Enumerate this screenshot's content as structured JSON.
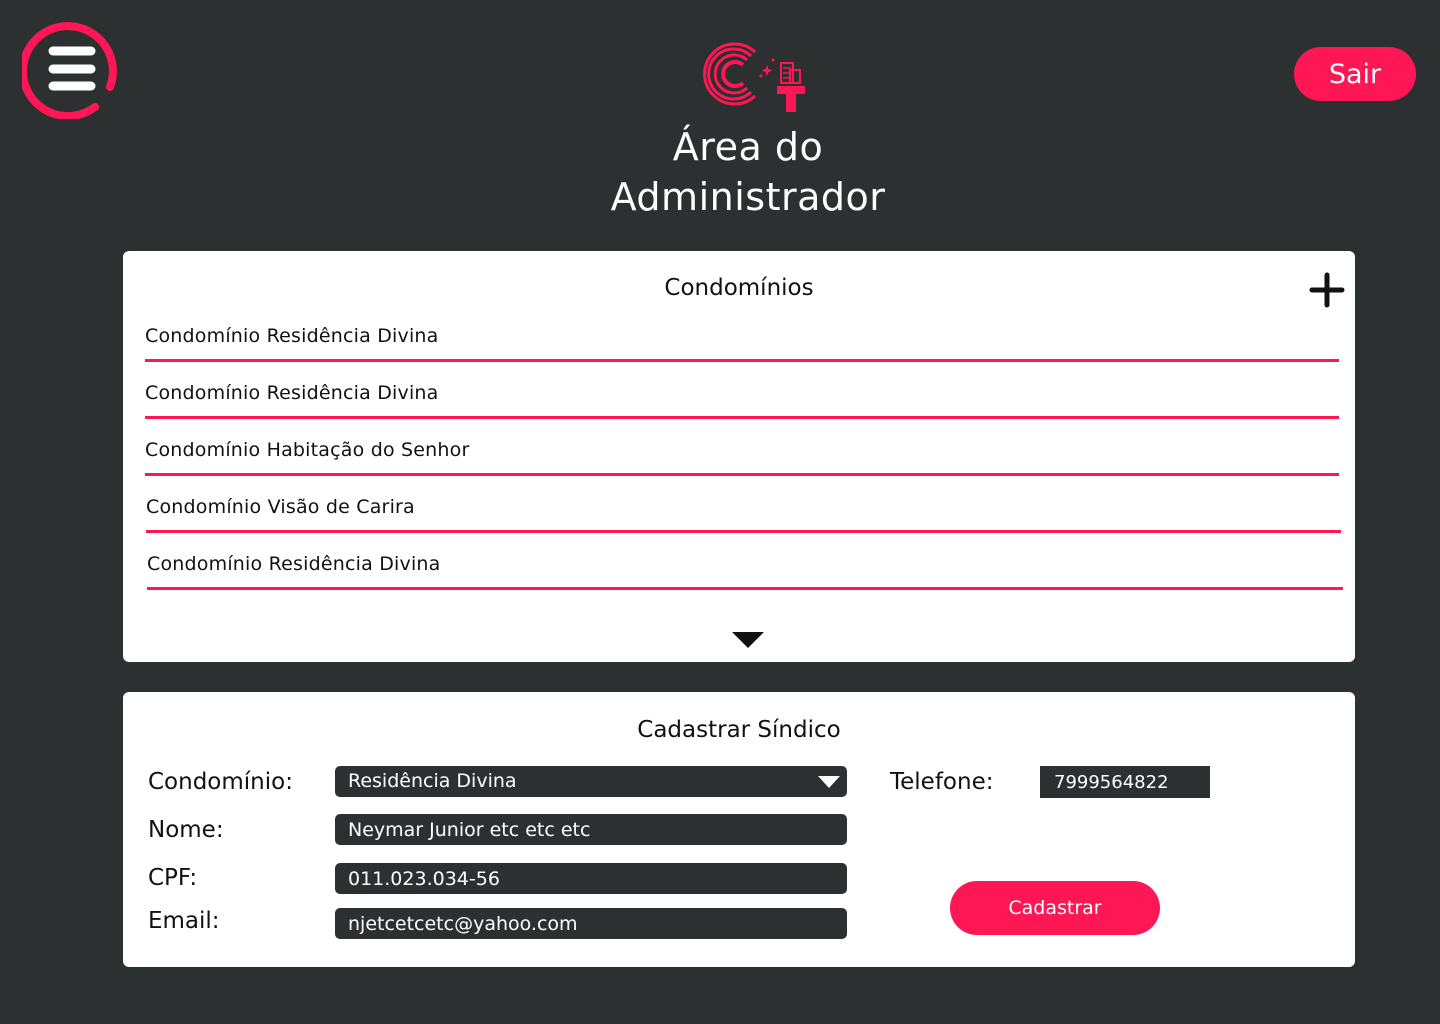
{
  "header": {
    "title_line1": "Área do",
    "title_line2": "Administrador",
    "logout_label": "Sair",
    "menu_icon": "hamburger-menu-icon",
    "logo_icon": "ct-building-logo"
  },
  "condominios": {
    "title": "Condomínios",
    "add_icon": "plus-icon",
    "expand_icon": "caret-down-icon",
    "items": [
      "Condomínio Residência Divina",
      "Condomínio Residência Divina",
      "Condomínio Habitação do Senhor",
      "Condomínio Visão de Carira",
      "Condomínio Residência Divina"
    ]
  },
  "form": {
    "title": "Cadastrar Síndico",
    "condominio_label": "Condomínio:",
    "condominio_value": "Residência Divina",
    "nome_label": "Nome:",
    "nome_value": "Neymar Junior etc etc etc",
    "cpf_label": "CPF:",
    "cpf_value": "011.023.034-56",
    "email_label": "Email:",
    "email_value": "njetcetcetc@yahoo.com",
    "telefone_label": "Telefone:",
    "telefone_value": "7999564822",
    "submit_label": "Cadastrar"
  },
  "colors": {
    "accent": "#ff1654",
    "background": "#2d3031",
    "card": "#ffffff"
  }
}
